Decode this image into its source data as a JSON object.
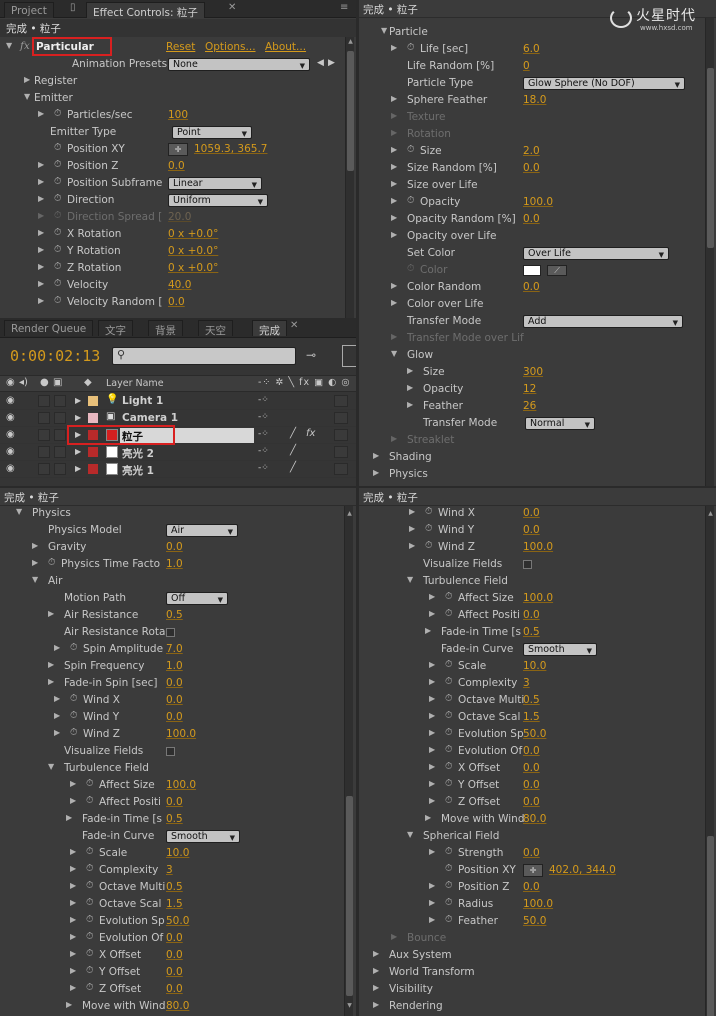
{
  "colors": {
    "bg": "#3b3b3b",
    "value": "#d49a1c",
    "highlight": "#d82020"
  },
  "watermark": {
    "logo_text": "火星时代",
    "url": "www.hxsd.com"
  },
  "effect_controls": {
    "tabs": [
      "Project",
      "Effect Controls: 粒子"
    ],
    "header": "完成 • 粒子",
    "effect": {
      "fx": "fx",
      "name": "Particular",
      "reset": "Reset",
      "options": "Options...",
      "about": "About..."
    },
    "presets": {
      "label": "Animation Presets:",
      "value": "None"
    },
    "register": "Register",
    "emitter": "Emitter",
    "rows": [
      {
        "label": "Particles/sec",
        "value": "100"
      },
      {
        "label": "Emitter Type",
        "select": "Point"
      },
      {
        "label": "Position XY",
        "value": "1059.3, 365.7"
      },
      {
        "label": "Position Z",
        "value": "0.0"
      },
      {
        "label": "Position Subframe",
        "select": "Linear"
      },
      {
        "label": "Direction",
        "select": "Uniform"
      },
      {
        "label": "Direction Spread [",
        "value": "20.0"
      },
      {
        "label": "X Rotation",
        "value": "0 x +0.0°"
      },
      {
        "label": "Y Rotation",
        "value": "0 x +0.0°"
      },
      {
        "label": "Z Rotation",
        "value": "0 x +0.0°"
      },
      {
        "label": "Velocity",
        "value": "40.0"
      },
      {
        "label": "Velocity Random [",
        "value": "0.0"
      }
    ]
  },
  "timeline": {
    "tabs": [
      "Render Queue",
      "文字",
      "背景",
      "天空",
      "完成"
    ],
    "timecode": "0:00:02:13",
    "search_placeholder": "",
    "col_layer_name": "Layer Name",
    "layers": [
      {
        "name": "Light 1",
        "color": "#e8c07a"
      },
      {
        "name": "Camera 1",
        "color": "#e8b8c0"
      },
      {
        "name": "粒子",
        "color": "#b82a2a"
      },
      {
        "name": "亮光 2",
        "color": "#b82a2a"
      },
      {
        "name": "亮光 1",
        "color": "#b82a2a"
      }
    ]
  },
  "particle_panel": {
    "header": "完成 • 粒子",
    "section": "Particle",
    "rows": [
      {
        "label": "Life [sec]",
        "value": "6.0"
      },
      {
        "label": "Life Random [%]",
        "value": "0"
      },
      {
        "label": "Particle Type",
        "select": "Glow Sphere (No DOF)"
      },
      {
        "label": "Sphere Feather",
        "value": "18.0"
      },
      {
        "label": "Texture"
      },
      {
        "label": "Rotation"
      },
      {
        "label": "Size",
        "value": "2.0"
      },
      {
        "label": "Size Random [%]",
        "value": "0.0"
      },
      {
        "label": "Size over Life"
      },
      {
        "label": "Opacity",
        "value": "100.0"
      },
      {
        "label": "Opacity Random [%]",
        "value": "0.0"
      },
      {
        "label": "Opacity over Life"
      },
      {
        "label": "Set Color",
        "select": "Over Life"
      },
      {
        "label": "Color"
      },
      {
        "label": "Color Random",
        "value": "0.0"
      },
      {
        "label": "Color over Life"
      },
      {
        "label": "Transfer Mode",
        "select": "Add"
      },
      {
        "label": "Transfer Mode over Lif"
      },
      {
        "label": "Glow"
      },
      {
        "label": "Size",
        "value": "300"
      },
      {
        "label": "Opacity",
        "value": "12"
      },
      {
        "label": "Feather",
        "value": "26"
      },
      {
        "label": "Transfer Mode",
        "select": "Normal"
      },
      {
        "label": "Streaklet"
      },
      {
        "label": "Shading"
      },
      {
        "label": "Physics"
      }
    ]
  },
  "physics_panel": {
    "header": "完成 • 粒子",
    "rows": [
      {
        "label": "Physics"
      },
      {
        "label": "Physics Model",
        "select": "Air"
      },
      {
        "label": "Gravity",
        "value": "0.0"
      },
      {
        "label": "Physics Time Facto",
        "value": "1.0"
      },
      {
        "label": "Air"
      },
      {
        "label": "Motion Path",
        "select": "Off"
      },
      {
        "label": "Air Resistance",
        "value": "0.5"
      },
      {
        "label": "Air Resistance Rota"
      },
      {
        "label": "Spin Amplitude",
        "value": "7.0"
      },
      {
        "label": "Spin Frequency",
        "value": "1.0"
      },
      {
        "label": "Fade-in Spin [sec]",
        "value": "0.0"
      },
      {
        "label": "Wind X",
        "value": "0.0"
      },
      {
        "label": "Wind Y",
        "value": "0.0"
      },
      {
        "label": "Wind Z",
        "value": "100.0"
      },
      {
        "label": "Visualize Fields"
      },
      {
        "label": "Turbulence Field"
      },
      {
        "label": "Affect Size",
        "value": "100.0"
      },
      {
        "label": "Affect Positi",
        "value": "0.0"
      },
      {
        "label": "Fade-in Time [s",
        "value": "0.5"
      },
      {
        "label": "Fade-in Curve",
        "select": "Smooth"
      },
      {
        "label": "Scale",
        "value": "10.0"
      },
      {
        "label": "Complexity",
        "value": "3"
      },
      {
        "label": "Octave Multi",
        "value": "0.5"
      },
      {
        "label": "Octave Scal",
        "value": "1.5"
      },
      {
        "label": "Evolution Sp",
        "value": "50.0"
      },
      {
        "label": "Evolution Of",
        "value": "0.0"
      },
      {
        "label": "X Offset",
        "value": "0.0"
      },
      {
        "label": "Y Offset",
        "value": "0.0"
      },
      {
        "label": "Z Offset",
        "value": "0.0"
      },
      {
        "label": "Move with Wind",
        "value": "80.0"
      }
    ]
  },
  "physics_panel2": {
    "header": "完成 • 粒子",
    "rows": [
      {
        "label": "Wind X",
        "value": "0.0"
      },
      {
        "label": "Wind Y",
        "value": "0.0"
      },
      {
        "label": "Wind Z",
        "value": "100.0"
      },
      {
        "label": "Visualize Fields"
      },
      {
        "label": "Turbulence Field"
      },
      {
        "label": "Affect Size",
        "value": "100.0"
      },
      {
        "label": "Affect Positi",
        "value": "0.0"
      },
      {
        "label": "Fade-in Time [s",
        "value": "0.5"
      },
      {
        "label": "Fade-in Curve",
        "select": "Smooth"
      },
      {
        "label": "Scale",
        "value": "10.0"
      },
      {
        "label": "Complexity",
        "value": "3"
      },
      {
        "label": "Octave Multi",
        "value": "0.5"
      },
      {
        "label": "Octave Scal",
        "value": "1.5"
      },
      {
        "label": "Evolution Sp",
        "value": "50.0"
      },
      {
        "label": "Evolution Of",
        "value": "0.0"
      },
      {
        "label": "X Offset",
        "value": "0.0"
      },
      {
        "label": "Y Offset",
        "value": "0.0"
      },
      {
        "label": "Z Offset",
        "value": "0.0"
      },
      {
        "label": "Move with Wind",
        "value": "80.0"
      },
      {
        "label": "Spherical Field"
      },
      {
        "label": "Strength",
        "value": "0.0"
      },
      {
        "label": "Position XY",
        "value": "402.0, 344.0"
      },
      {
        "label": "Position Z",
        "value": "0.0"
      },
      {
        "label": "Radius",
        "value": "100.0"
      },
      {
        "label": "Feather",
        "value": "50.0"
      },
      {
        "label": "Bounce"
      },
      {
        "label": "Aux System"
      },
      {
        "label": "World Transform"
      },
      {
        "label": "Visibility"
      },
      {
        "label": "Rendering"
      }
    ]
  }
}
